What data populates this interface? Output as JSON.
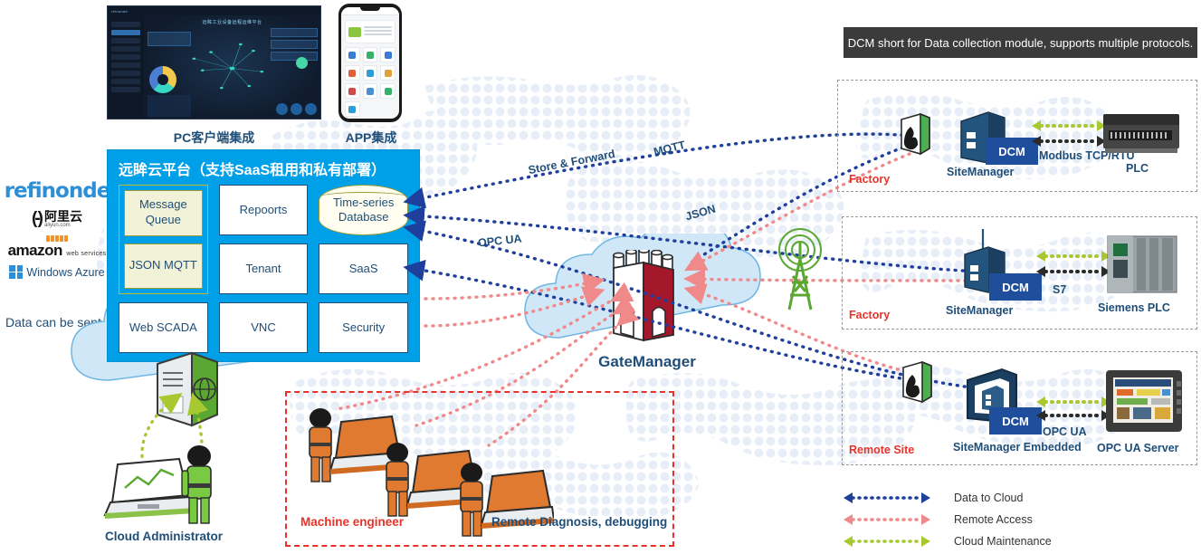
{
  "top_devices": {
    "pc_label": "PC客户端集成",
    "app_label": "APP集成",
    "pc_dashboard_title": "远眸工业设备远程运维平台",
    "pc_brand": "reinonde"
  },
  "providers": {
    "sent_to_text": "Data can be sent to",
    "items": [
      {
        "name": "remonde",
        "text": "reﬁnonde"
      },
      {
        "name": "aliyun",
        "mark": "(-)",
        "cn": "阿里云",
        "domain": "aliyun.com"
      },
      {
        "name": "amazon-web-services",
        "title": "amazon",
        "sub": "web services"
      },
      {
        "name": "windows-azure",
        "text": "Windows Azure"
      }
    ]
  },
  "cloud_platform": {
    "title": "远眸云平台（支持SaaS租用和私有部署）",
    "cells": [
      {
        "label": "Repoorts",
        "type": "plain"
      },
      {
        "label": "Time-series Database",
        "type": "database"
      },
      {
        "label": "Tenant",
        "type": "plain"
      },
      {
        "label": "SaaS",
        "type": "plain"
      },
      {
        "label": "Web SCADA",
        "type": "plain"
      },
      {
        "label": "VNC",
        "type": "plain"
      },
      {
        "label": "Security",
        "type": "plain"
      }
    ],
    "message_queue": "Message Queue",
    "json_mqtt": "JSON MQTT"
  },
  "center": {
    "gatemanager_label": "GateManager",
    "protocols": {
      "store_forward": "Store & Forward",
      "mqtt": "MQTT",
      "json": "JSON",
      "opc_ua": "OPC UA"
    }
  },
  "dcm_banner": "DCM short for Data collection module, supports multiple protocols.",
  "sites": [
    {
      "tag": "Factory",
      "gateway": "SiteManager",
      "badge": "DCM",
      "protocol": "Modbus TCP/RTU",
      "device": "PLC"
    },
    {
      "tag": "Factory",
      "gateway": "SiteManager",
      "badge": "DCM",
      "protocol": "S7",
      "device": "Siemens PLC"
    },
    {
      "tag": "Remote Site",
      "gateway": "SiteManager Embedded",
      "badge": "DCM",
      "protocol": "OPC UA",
      "device": "OPC UA Server"
    }
  ],
  "legend": {
    "items": [
      {
        "label": "Data to Cloud",
        "color": "#1f3f9c"
      },
      {
        "label": "Remote Access",
        "color": "#f08a8a"
      },
      {
        "label": "Cloud Maintenance",
        "color": "#a8c832"
      }
    ]
  },
  "bottom": {
    "cloud_admin": "Cloud Administrator",
    "machine_engineer": "Machine engineer",
    "remote_diagnosis": "Remote Diagnosis,  debugging"
  },
  "colors": {
    "platform_blue": "#00a0e9",
    "cloud_fill": "#cfe7f7",
    "cloud_stroke": "#6fb6e3",
    "navy": "#1f4e79",
    "red": "#e8332a",
    "banner_dark": "#3b3b3b",
    "dcm_blue": "#1f4e9c",
    "data_to_cloud": "#1f3f9c",
    "remote_access": "#f08a8a",
    "cloud_maintenance": "#a8c832"
  }
}
